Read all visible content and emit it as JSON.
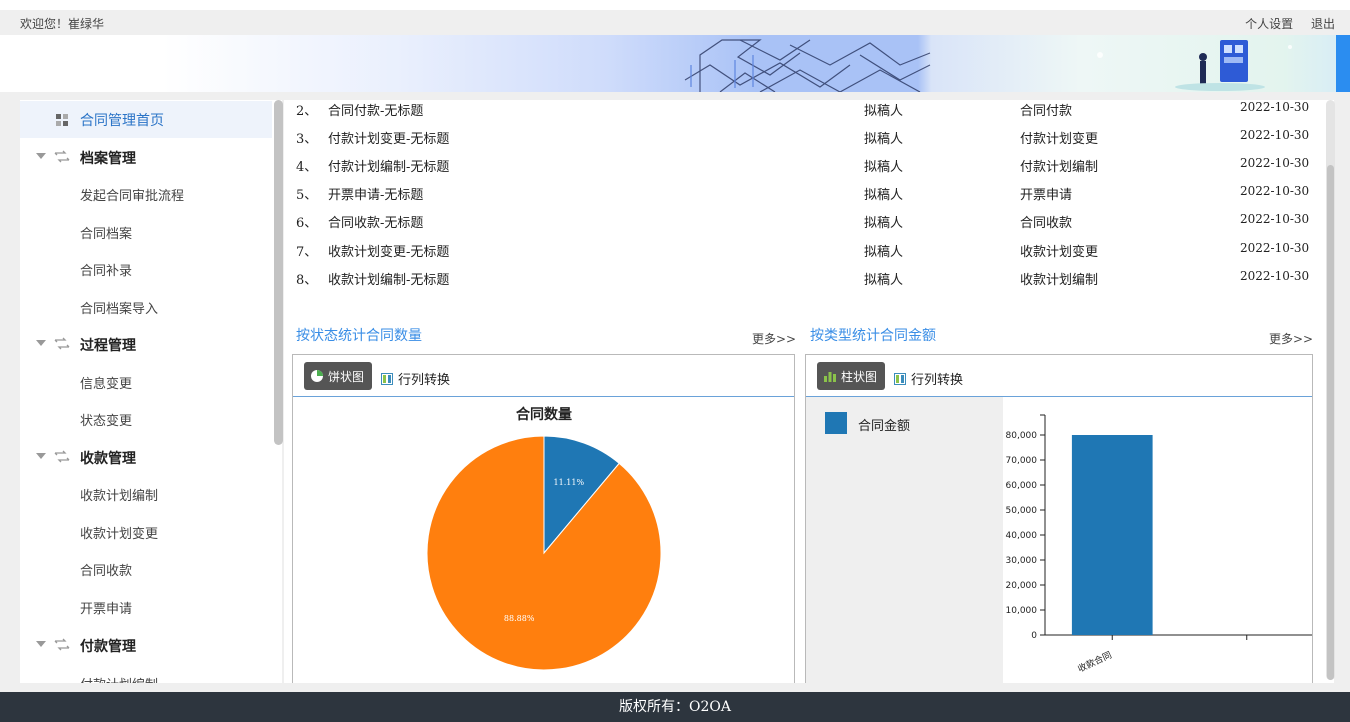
{
  "header": {
    "welcome": "欢迎您！崔绿华",
    "settings_label": "个人设置",
    "logout_label": "退出"
  },
  "sidebar": {
    "home_label": "合同管理首页",
    "groups": [
      {
        "label": "档案管理",
        "items": [
          "发起合同审批流程",
          "合同档案",
          "合同补录",
          "合同档案导入"
        ]
      },
      {
        "label": "过程管理",
        "items": [
          "信息变更",
          "状态变更"
        ]
      },
      {
        "label": "收款管理",
        "items": [
          "收款计划编制",
          "收款计划变更",
          "合同收款",
          "开票申请"
        ]
      },
      {
        "label": "付款管理",
        "items": [
          "付款计划编制"
        ]
      }
    ]
  },
  "task_list": [
    {
      "no": "2、",
      "title": "合同付款-无标题",
      "role": "拟稿人",
      "type": "合同付款",
      "date": "2022-10-30"
    },
    {
      "no": "3、",
      "title": "付款计划变更-无标题",
      "role": "拟稿人",
      "type": "付款计划变更",
      "date": "2022-10-30"
    },
    {
      "no": "4、",
      "title": "付款计划编制-无标题",
      "role": "拟稿人",
      "type": "付款计划编制",
      "date": "2022-10-30"
    },
    {
      "no": "5、",
      "title": "开票申请-无标题",
      "role": "拟稿人",
      "type": "开票申请",
      "date": "2022-10-30"
    },
    {
      "no": "6、",
      "title": "合同收款-无标题",
      "role": "拟稿人",
      "type": "合同收款",
      "date": "2022-10-30"
    },
    {
      "no": "7、",
      "title": "收款计划变更-无标题",
      "role": "拟稿人",
      "type": "收款计划变更",
      "date": "2022-10-30"
    },
    {
      "no": "8、",
      "title": "收款计划编制-无标题",
      "role": "拟稿人",
      "type": "收款计划编制",
      "date": "2022-10-30"
    }
  ],
  "status_section": {
    "title": "按状态统计合同数量",
    "more": "更多>>",
    "chart_btn": "饼状图",
    "pivot_btn": "行列转换"
  },
  "type_section": {
    "title": "按类型统计合同金额",
    "more": "更多>>",
    "chart_btn": "柱状图",
    "pivot_btn": "行列转换"
  },
  "chart_data": [
    {
      "type": "pie",
      "title": "合同数量",
      "slices": [
        {
          "label": "11.11%",
          "value": 11.11,
          "color": "#1f77b4"
        },
        {
          "label": "88.88%",
          "value": 88.89,
          "color": "#ff7f0e"
        }
      ]
    },
    {
      "type": "bar",
      "categories": [
        "收款合同",
        ""
      ],
      "series": [
        {
          "name": "合同金额",
          "values": [
            80000
          ],
          "color": "#1f77b4"
        }
      ],
      "y_ticks": [
        "0",
        "10,000",
        "20,000",
        "30,000",
        "40,000",
        "50,000",
        "60,000",
        "70,000",
        "80,000"
      ],
      "ylim": [
        0,
        80000
      ]
    }
  ],
  "footer": {
    "copyright": "版权所有：O2OA"
  }
}
